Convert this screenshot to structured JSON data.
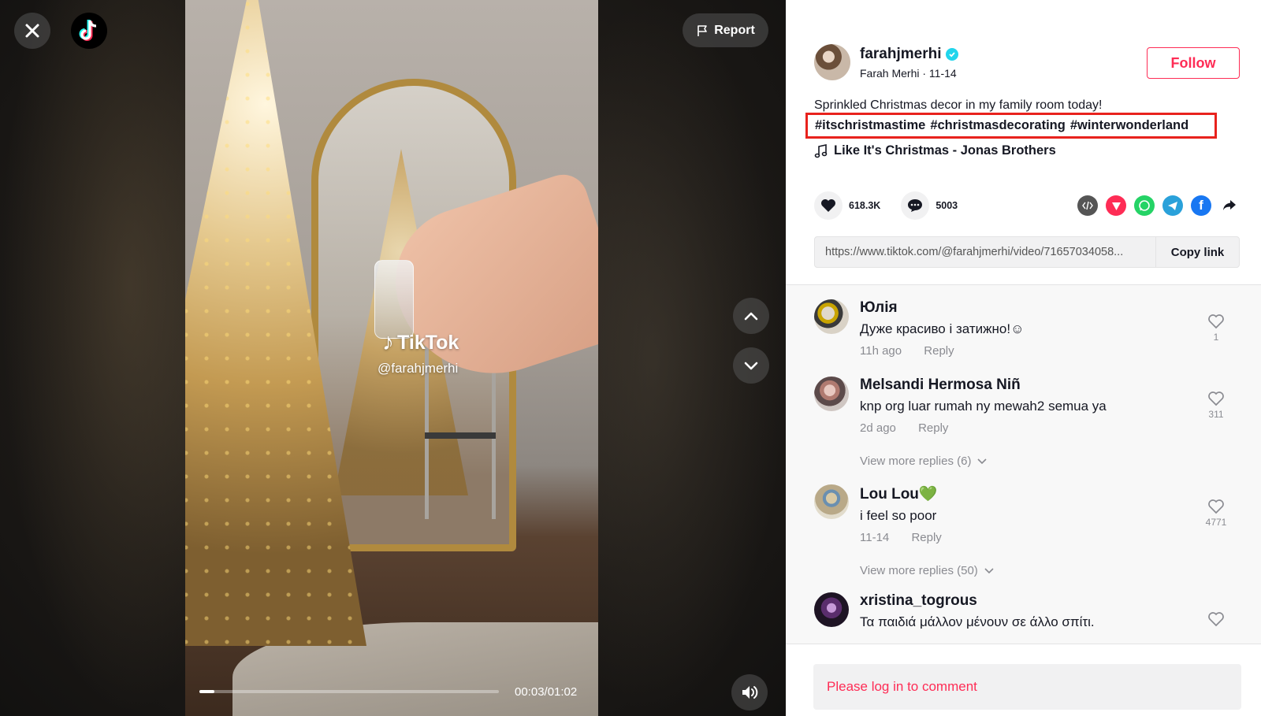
{
  "player": {
    "watermark_brand": "TikTok",
    "watermark_handle": "@farahjmerhi",
    "time_display": "00:03/01:02",
    "progress": 0.05,
    "report_label": "Report"
  },
  "post": {
    "username": "farahjmerhi",
    "display_name": "Farah Merhi",
    "date": "11-14",
    "follow_label": "Follow",
    "caption": "Sprinkled Christmas decor in my family room today!",
    "hashtags": [
      "#itschristmastime",
      "#christmasdecorating",
      "#winterwonderland"
    ],
    "music": "Like It's Christmas - Jonas Brothers",
    "likes": "618.3K",
    "comments_count": "5003",
    "link": "https://www.tiktok.com/@farahjmerhi/video/71657034058...",
    "copy_label": "Copy link"
  },
  "comments": [
    {
      "name": "Юлія",
      "text": "Дуже красиво і затижно!☺",
      "time": "11h ago",
      "reply": "Reply",
      "likes": "1"
    },
    {
      "name": "Melsandi Hermosa Niñ",
      "text": "knp org luar rumah ny mewah2 semua ya",
      "time": "2d ago",
      "reply": "Reply",
      "likes": "311",
      "more": "View more replies (6)"
    },
    {
      "name": "Lou Lou💚",
      "text": "i feel so poor",
      "time": "11-14",
      "reply": "Reply",
      "likes": "4771",
      "more": "View more replies (50)"
    },
    {
      "name": "xristina_togrous",
      "text": "Τα παιδιά μάλλον μένουν σε άλλο σπίτι.",
      "time": "",
      "reply": "",
      "likes": ""
    }
  ],
  "login_prompt": "Please log in to comment",
  "colors": {
    "accent": "#fe2c55",
    "highlight_box": "#e8221d",
    "verified": "#20d5ec"
  }
}
